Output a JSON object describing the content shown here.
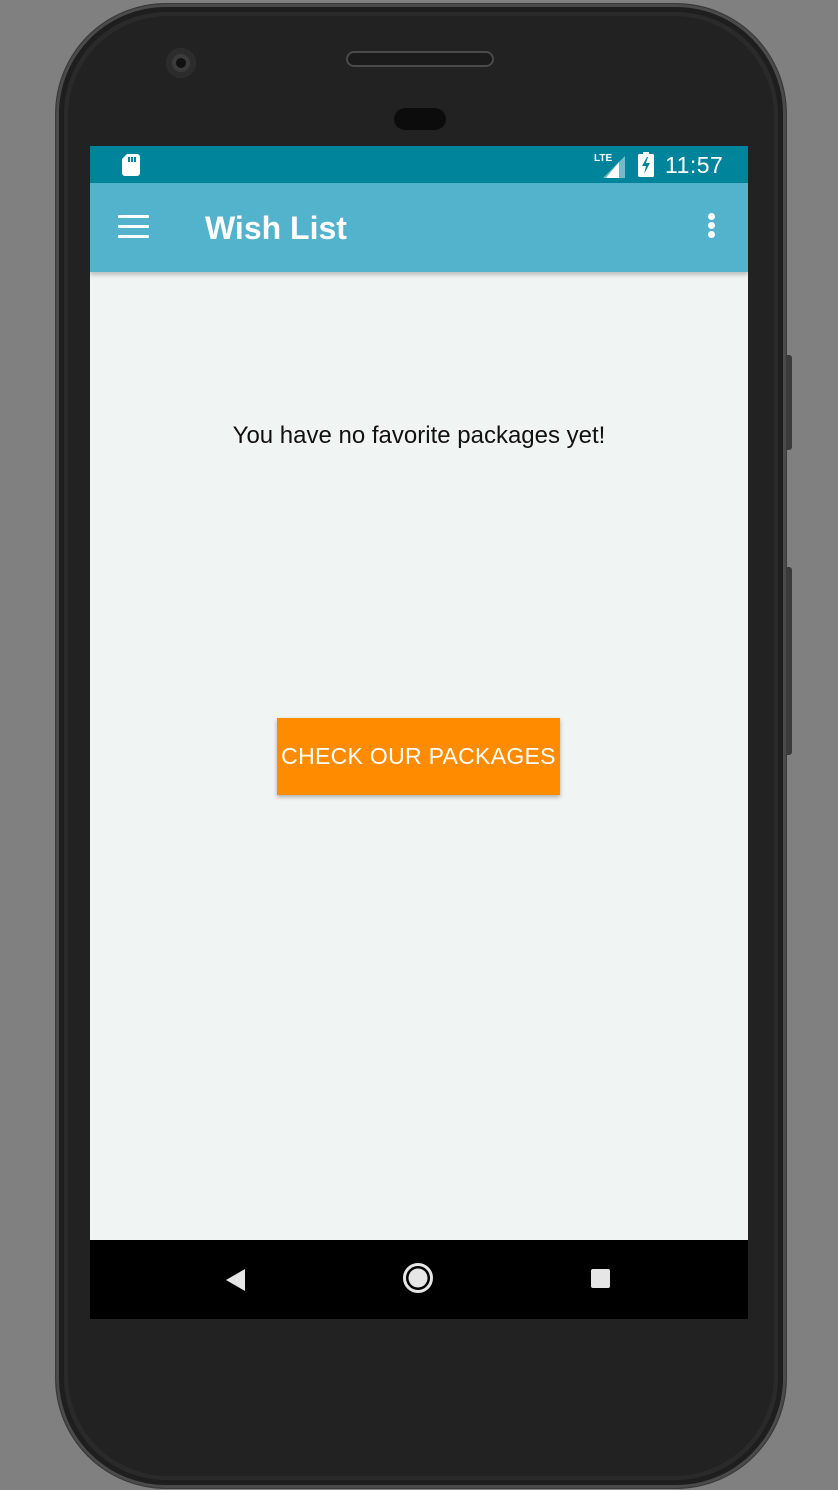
{
  "status_bar": {
    "time": "11:57",
    "network_label": "LTE",
    "icons": [
      "sd-card-icon",
      "lte-signal-icon",
      "battery-charging-icon"
    ]
  },
  "app_bar": {
    "title": "Wish List",
    "menu_icon": "hamburger-menu-icon",
    "overflow_icon": "more-vert-icon"
  },
  "content": {
    "empty_message": "You have no favorite packages yet!",
    "cta_label": "CHECK OUR PACKAGES"
  },
  "nav_bar": {
    "icons": [
      "back-icon",
      "home-icon",
      "recents-icon"
    ]
  },
  "colors": {
    "status_bar": "#00849b",
    "app_bar": "#53b3cc",
    "background": "#f0f5f3",
    "accent_button": "#ff8c00",
    "nav_bar": "#000000"
  }
}
